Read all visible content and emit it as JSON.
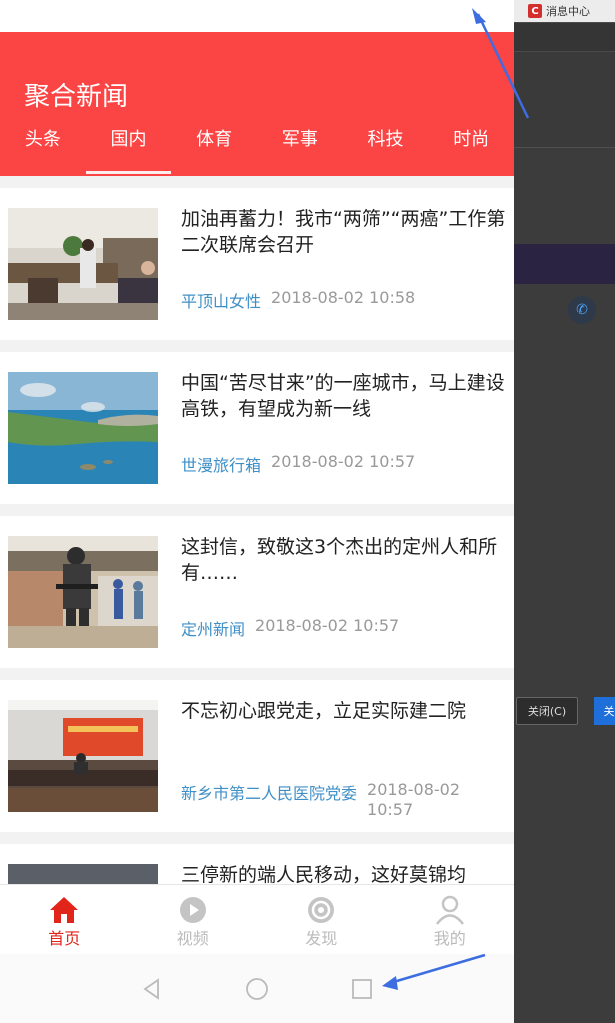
{
  "background_window": {
    "tab_logo": "C",
    "tab_title": "消息中心",
    "close_label": "关闭(C)",
    "blue_label": "关"
  },
  "app": {
    "title": "聚合新闻",
    "tabs": [
      "头条",
      "国内",
      "体育",
      "军事",
      "科技",
      "时尚"
    ],
    "active_tab": "国内"
  },
  "news": [
    {
      "title": "加油再蓄力！我市“两筛”“两癌”工作第二次联席会召开",
      "source": "平顶山女性",
      "time": "2018-08-02 10:58",
      "image": "meeting-room-photo"
    },
    {
      "title": "中国“苦尽甘来”的一座城市，马上建设高铁，有望成为新一线",
      "source": "世漫旅行箱",
      "time": "2018-08-02 10:57",
      "image": "coastline-aerial-photo"
    },
    {
      "title": "这封信，致敬这3个杰出的定州人和所有……",
      "source": "定州新闻",
      "time": "2018-08-02 10:57",
      "image": "armed-officer-photo"
    },
    {
      "title": "不忘初心跟党走，立足实际建二院",
      "source": "新乡市第二人民医院党委",
      "time": "2018-08-02 10:57",
      "image": "conference-hall-photo"
    },
    {
      "title": "三停新的端人民移动，这好莫锦均",
      "source": "",
      "time": "",
      "image": "partial-photo"
    }
  ],
  "bottom_nav": [
    {
      "label": "首页",
      "icon": "home-icon",
      "active": true
    },
    {
      "label": "视频",
      "icon": "play-icon",
      "active": false
    },
    {
      "label": "发现",
      "icon": "compass-icon",
      "active": false
    },
    {
      "label": "我的",
      "icon": "user-icon",
      "active": false
    }
  ],
  "colors": {
    "header": "#fb4444",
    "source_link": "#3f8fc7",
    "active_nav": "#e1251b"
  }
}
